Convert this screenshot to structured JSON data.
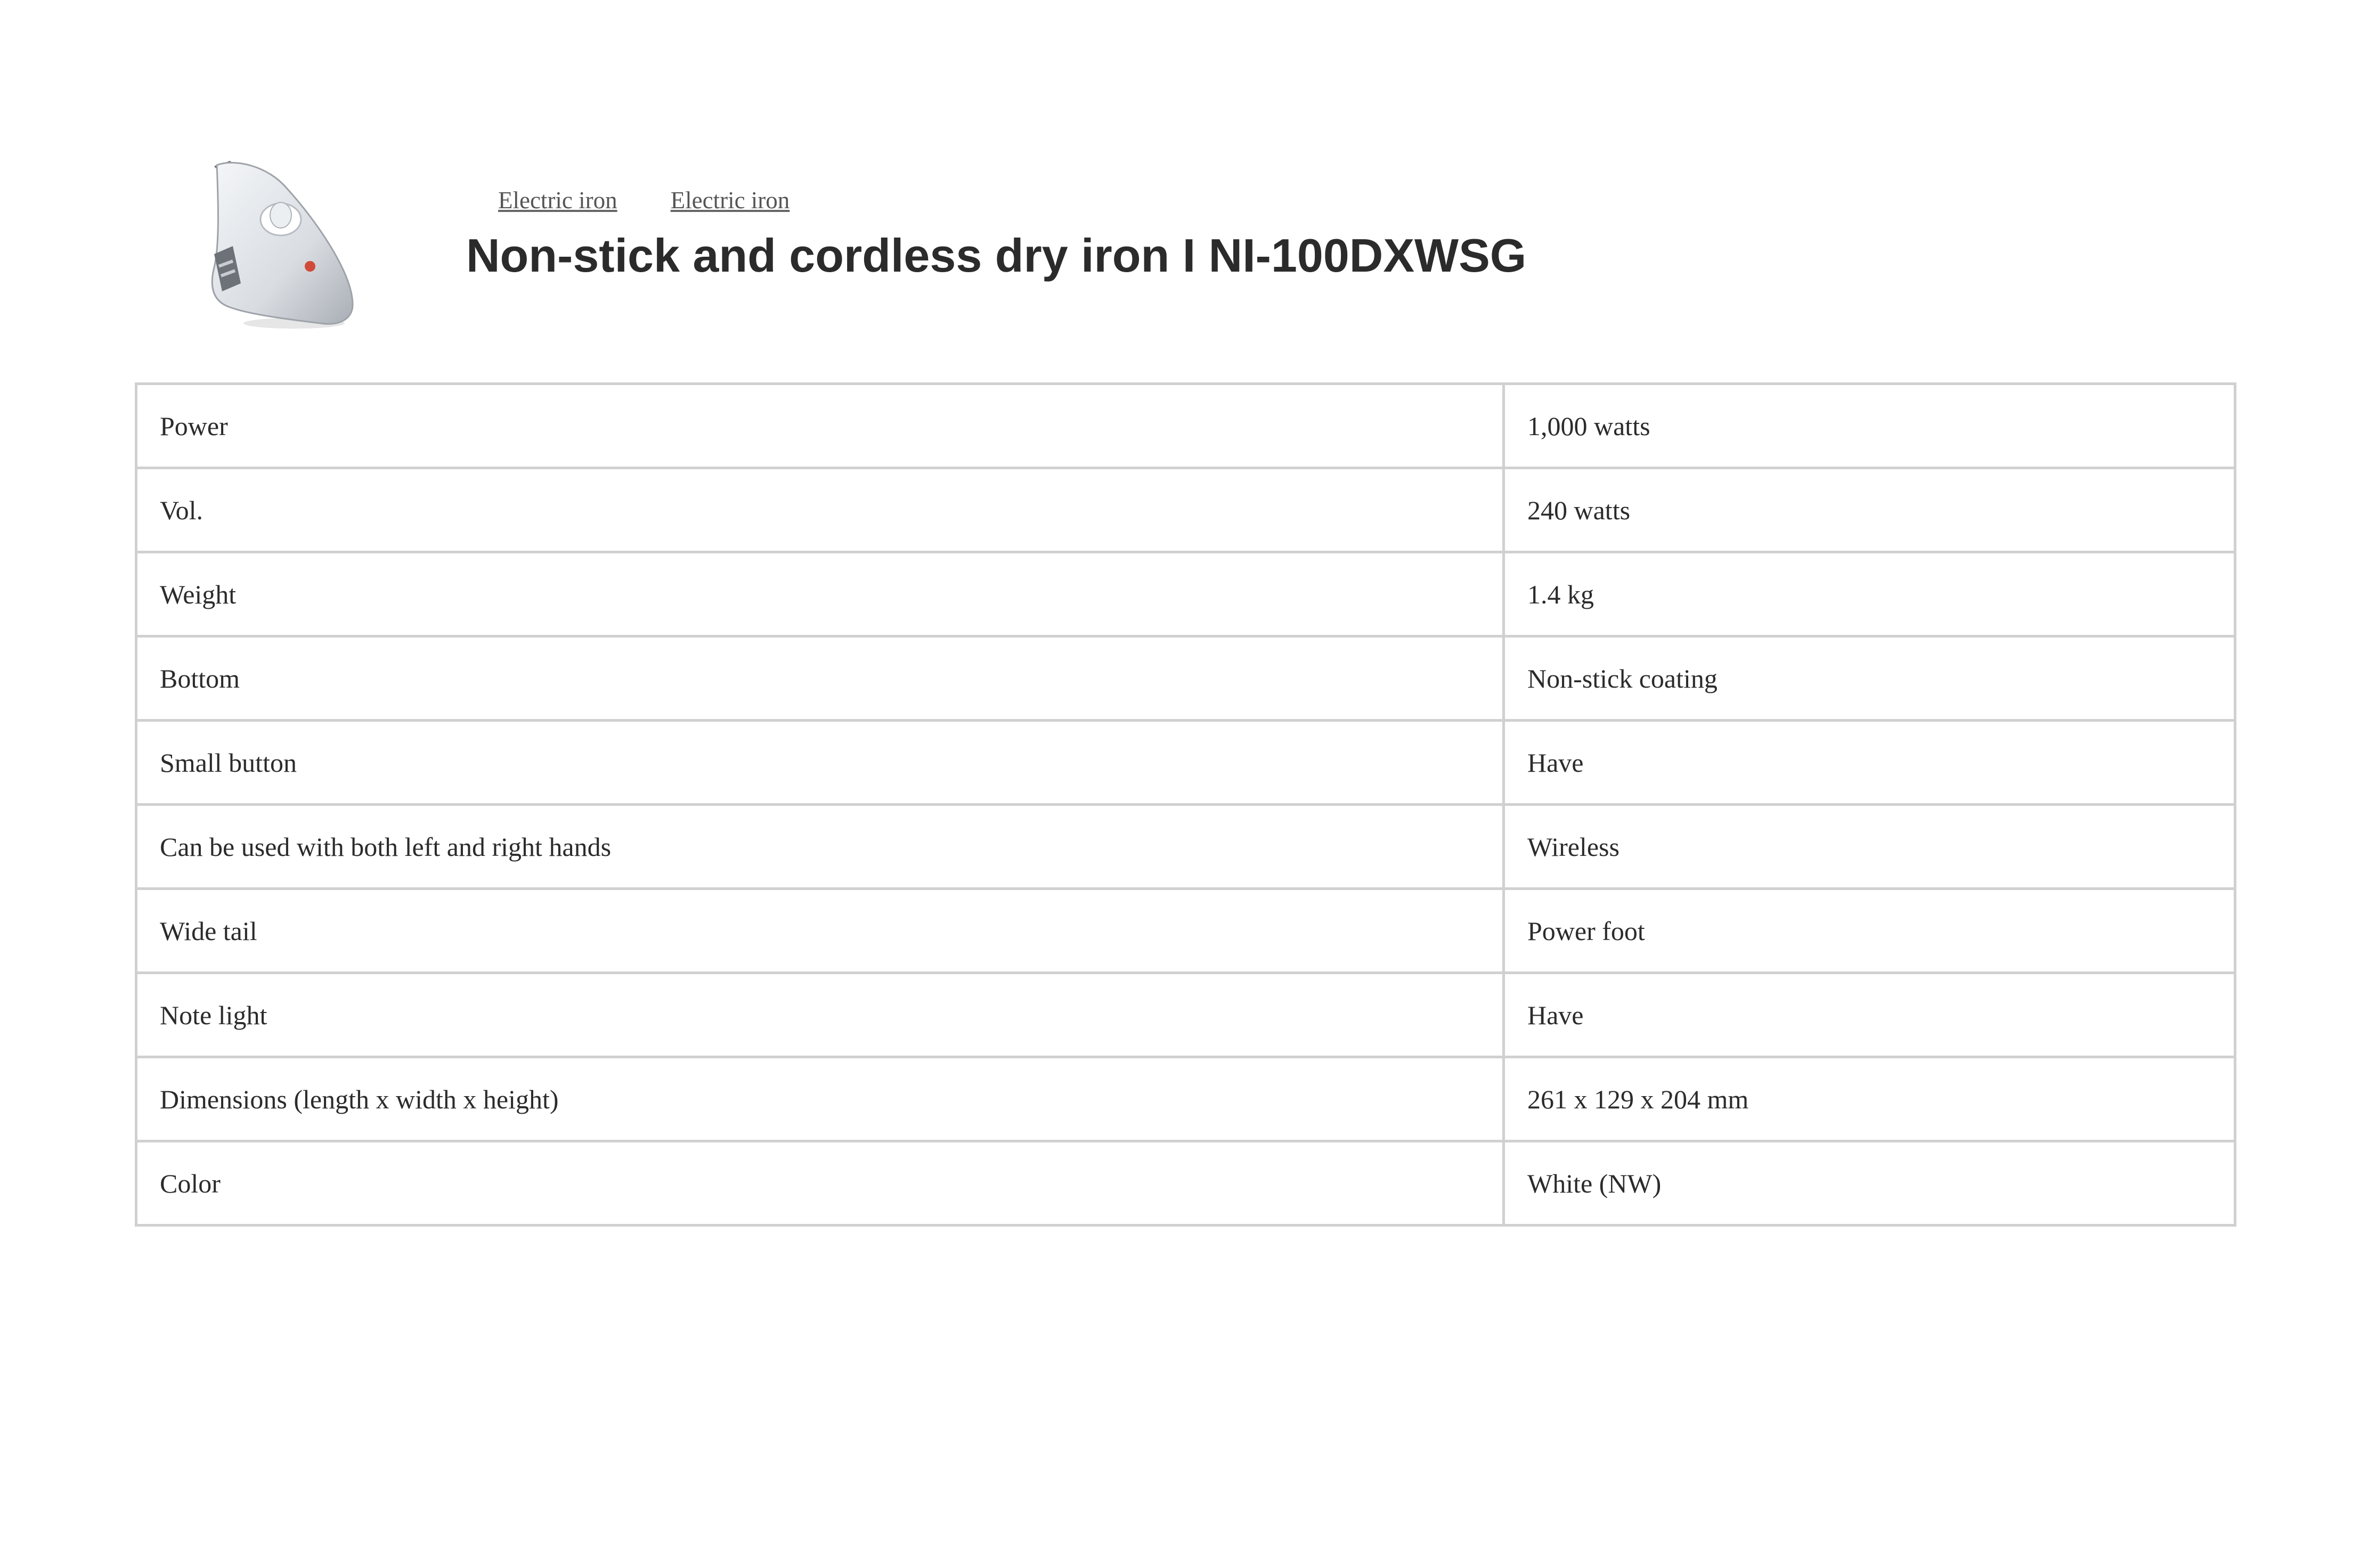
{
  "header": {
    "image_alt": "Non-stick and cordless dry iron",
    "breadcrumb": [
      "Electric iron",
      "Electric iron"
    ],
    "title": "Non-stick and cordless dry iron I NI-100DXWSG"
  },
  "specs": [
    {
      "label": "Power",
      "value": "1,000 watts"
    },
    {
      "label": "Vol.",
      "value": "240 watts"
    },
    {
      "label": "Weight",
      "value": "1.4 kg"
    },
    {
      "label": "Bottom",
      "value": "Non-stick coating"
    },
    {
      "label": "Small button",
      "value": "Have"
    },
    {
      "label": "Can be used with both left and right hands",
      "value": "Wireless"
    },
    {
      "label": "Wide tail",
      "value": "Power foot"
    },
    {
      "label": "Note light",
      "value": "Have"
    },
    {
      "label": "Dimensions (length x width x height)",
      "value": "261 x 129 x 204 mm"
    },
    {
      "label": "Color",
      "value": "White (NW)"
    }
  ]
}
